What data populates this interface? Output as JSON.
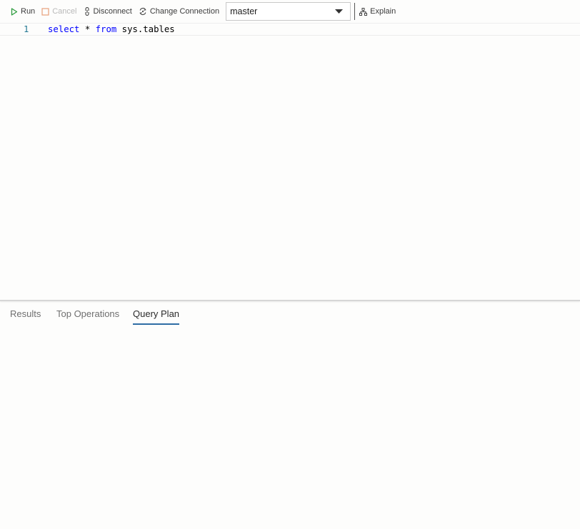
{
  "toolbar": {
    "run_label": "Run",
    "cancel_label": "Cancel",
    "disconnect_label": "Disconnect",
    "change_connection_label": "Change Connection",
    "database_value": "master",
    "explain_label": "Explain"
  },
  "editor": {
    "lines": [
      {
        "number": "1",
        "tokens": [
          {
            "text": "select",
            "kind": "keyword"
          },
          {
            "text": " * ",
            "kind": "plain"
          },
          {
            "text": "from",
            "kind": "keyword"
          },
          {
            "text": " sys.tables",
            "kind": "plain"
          }
        ]
      }
    ]
  },
  "results": {
    "tabs": [
      {
        "label": "Results",
        "active": false
      },
      {
        "label": "Top Operations",
        "active": false
      },
      {
        "label": "Query Plan",
        "active": true
      }
    ]
  },
  "colors": {
    "run_icon": "#2e9c3e",
    "cancel_icon": "#e8a07a",
    "keyword": "#0000ff",
    "line_number": "#237893",
    "active_tab_underline": "#2e6da4"
  },
  "icons": {
    "run": "play-icon",
    "cancel": "stop-icon",
    "disconnect": "disconnect-icon",
    "change_connection": "change-connection-icon",
    "dropdown": "chevron-down-icon",
    "explain": "explain-icon"
  }
}
